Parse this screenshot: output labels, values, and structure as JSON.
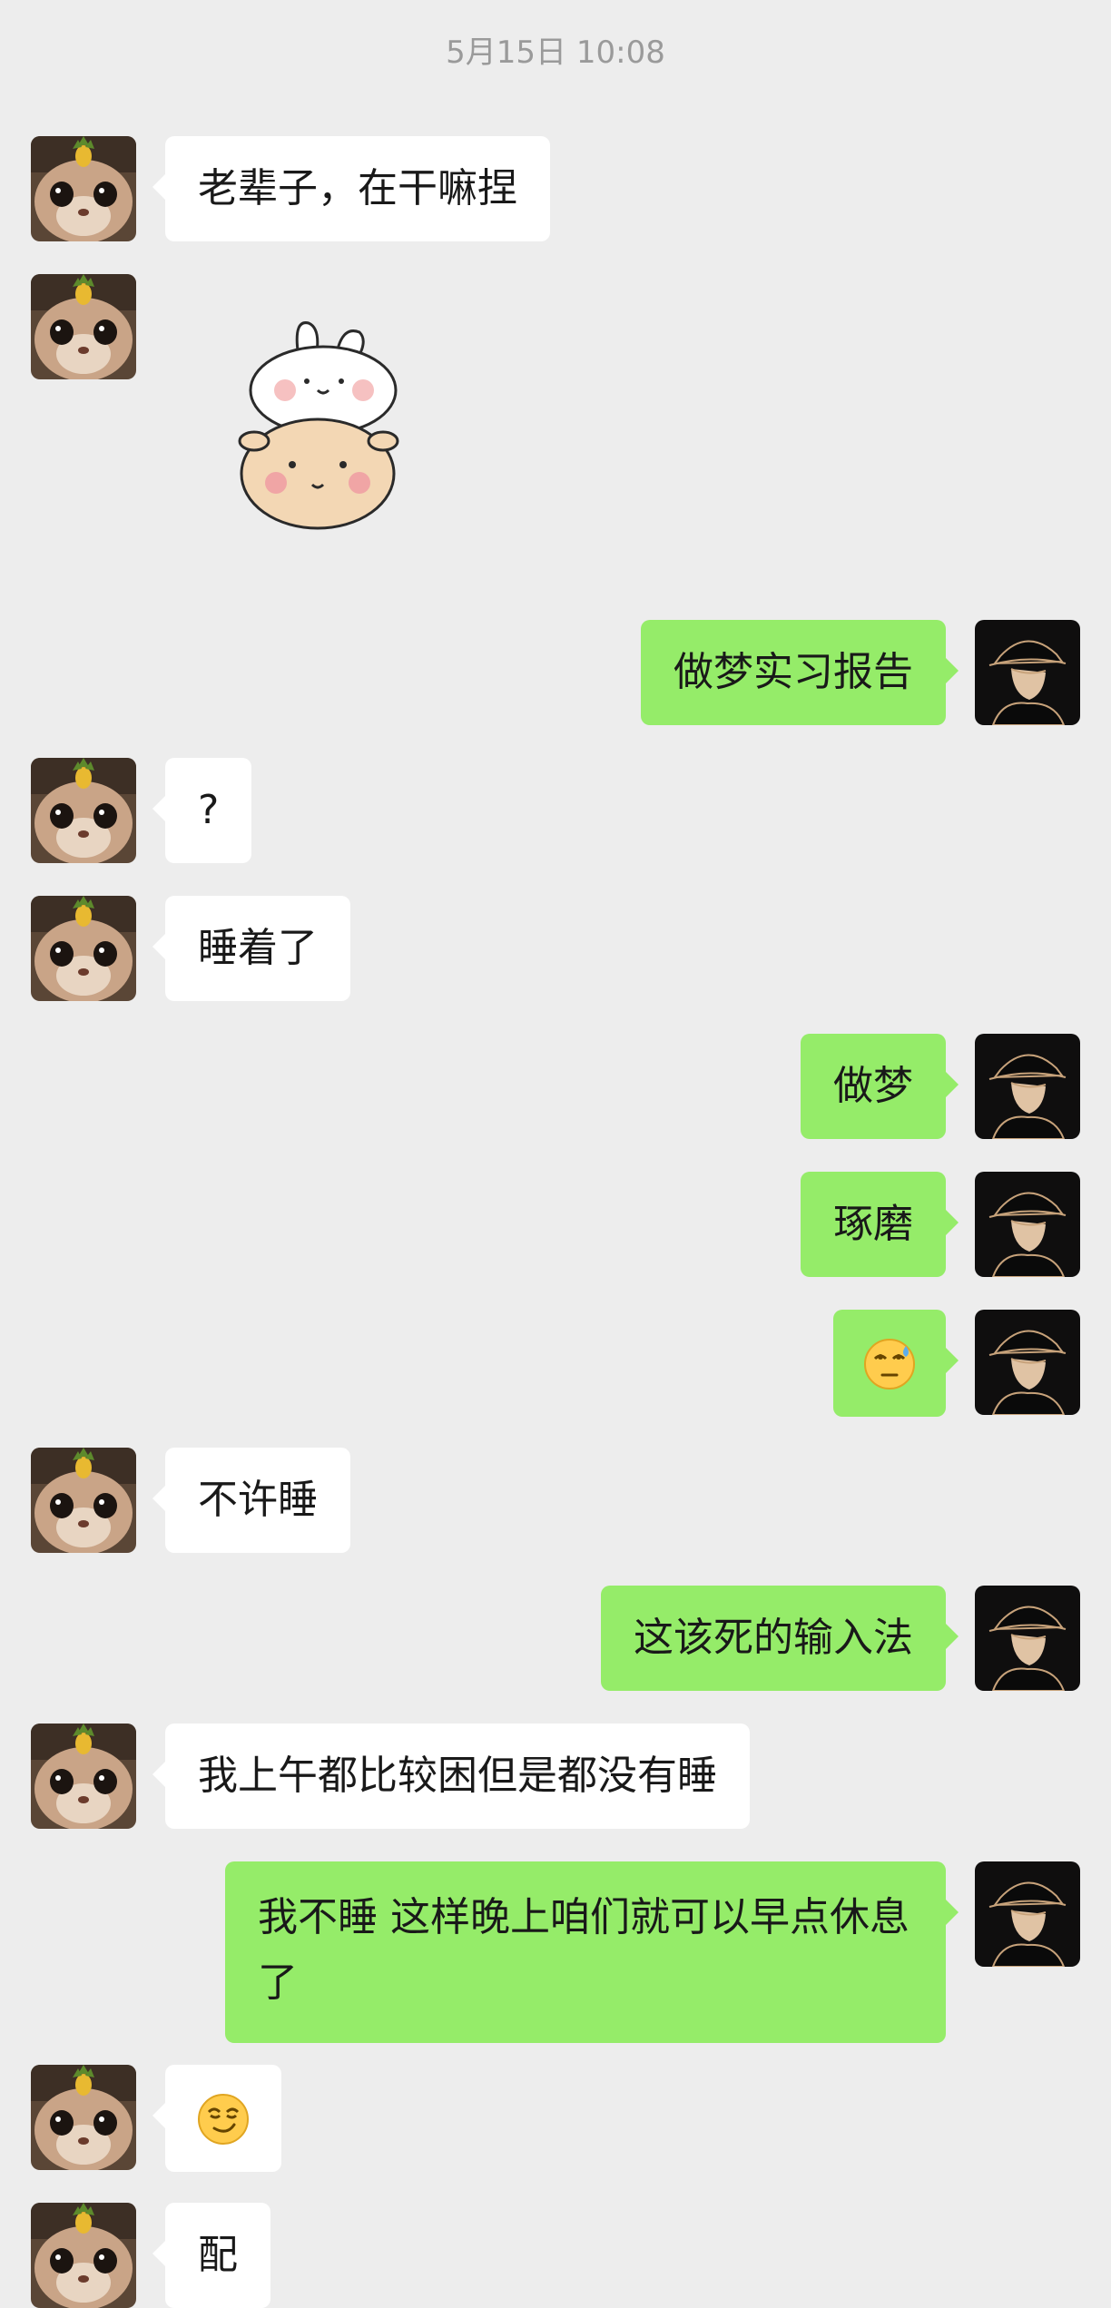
{
  "header": {
    "timestamp": "5月15日 10:08"
  },
  "messages": [
    {
      "side": "left",
      "type": "text",
      "text": "老辈子，在干嘛捏"
    },
    {
      "side": "left",
      "type": "sticker",
      "sticker": "bunny-cow-sticker"
    },
    {
      "side": "right",
      "type": "text",
      "text": "做梦实习报告"
    },
    {
      "side": "left",
      "type": "text",
      "text": "?"
    },
    {
      "side": "left",
      "type": "text",
      "text": "睡着了"
    },
    {
      "side": "right",
      "type": "text",
      "text": "做梦"
    },
    {
      "side": "right",
      "type": "text",
      "text": "琢磨"
    },
    {
      "side": "right",
      "type": "emoji",
      "emoji": "sweat-rolling-eyes-emoji"
    },
    {
      "side": "left",
      "type": "text",
      "text": "不许睡"
    },
    {
      "side": "right",
      "type": "text",
      "text": "这该死的输入法"
    },
    {
      "side": "left",
      "type": "text",
      "text": "我上午都比较困但是都没有睡"
    },
    {
      "side": "right",
      "type": "text",
      "text": "我不睡 这样晚上咱们就可以早点休息了"
    },
    {
      "side": "left",
      "type": "emoji",
      "emoji": "smirk-emoji"
    },
    {
      "side": "left",
      "type": "text",
      "text": "配"
    }
  ],
  "colors": {
    "background": "#ededed",
    "self_bubble": "#95ec69",
    "other_bubble": "#ffffff",
    "timestamp": "#9a9a9a"
  },
  "icons": {
    "friend_avatar": "cat-with-pineapple-avatar",
    "self_avatar": "man-in-black-hat-avatar"
  }
}
